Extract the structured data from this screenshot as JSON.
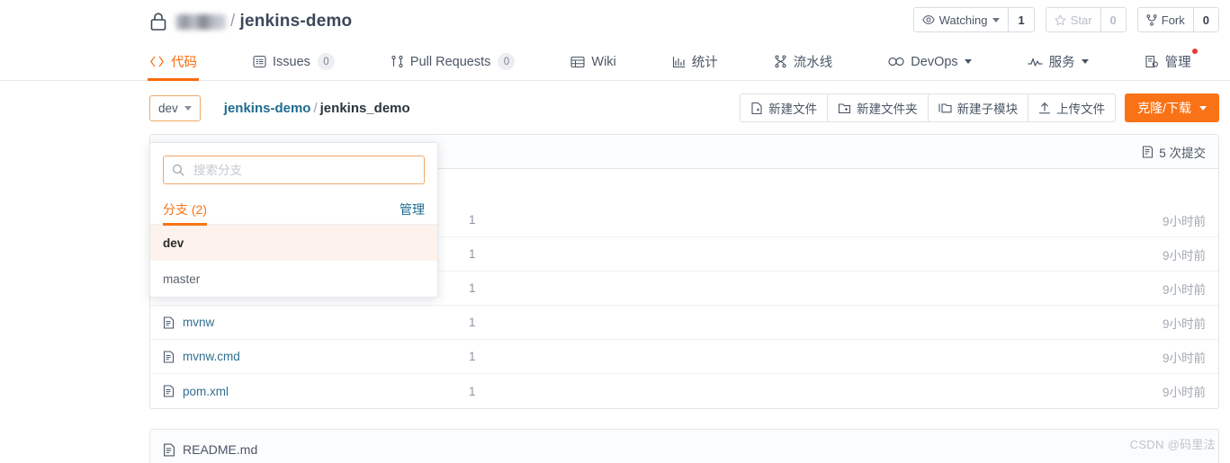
{
  "header": {
    "lock_icon": "lock-icon",
    "owner_redacted": "",
    "separator": "/",
    "repo_name": "jenkins-demo",
    "watch": {
      "icon": "eye-icon",
      "label": "Watching",
      "count": "1"
    },
    "star": {
      "icon": "star-icon",
      "label": "Star",
      "count": "0"
    },
    "fork": {
      "icon": "fork-icon",
      "label": "Fork",
      "count": "0"
    }
  },
  "nav": {
    "items": [
      {
        "icon": "code-icon",
        "label": "代码",
        "count": null,
        "active": true,
        "caret": false,
        "dot": false
      },
      {
        "icon": "issue-icon",
        "label": "Issues",
        "count": "0",
        "active": false,
        "caret": false,
        "dot": false
      },
      {
        "icon": "pr-icon",
        "label": "Pull Requests",
        "count": "0",
        "active": false,
        "caret": false,
        "dot": false
      },
      {
        "icon": "wiki-icon",
        "label": "Wiki",
        "count": null,
        "active": false,
        "caret": false,
        "dot": false
      },
      {
        "icon": "chart-icon",
        "label": "统计",
        "count": null,
        "active": false,
        "caret": false,
        "dot": false
      },
      {
        "icon": "pipe-icon",
        "label": "流水线",
        "count": null,
        "active": false,
        "caret": false,
        "dot": false
      },
      {
        "icon": "infinity-icon",
        "label": "DevOps",
        "count": null,
        "active": false,
        "caret": true,
        "dot": false
      },
      {
        "icon": "pulse-icon",
        "label": "服务",
        "count": null,
        "active": false,
        "caret": true,
        "dot": false
      },
      {
        "icon": "manage-icon",
        "label": "管理",
        "count": null,
        "active": false,
        "caret": false,
        "dot": true
      }
    ]
  },
  "toolbar": {
    "branch_button": {
      "label": "dev",
      "icon": "chevron-down-icon"
    },
    "breadcrumb": {
      "root": "jenkins-demo",
      "separator": "/",
      "current": "jenkins_demo"
    },
    "buttons": [
      {
        "icon": "new-file-icon",
        "label": "新建文件"
      },
      {
        "icon": "new-folder-icon",
        "label": "新建文件夹"
      },
      {
        "icon": "new-submodule-icon",
        "label": "新建子模块"
      },
      {
        "icon": "upload-icon",
        "label": "上传文件"
      }
    ],
    "primary_button": {
      "label": "克隆/下载",
      "icon": "chevron-down-icon"
    }
  },
  "file_table": {
    "commits": {
      "icon": "commit-icon",
      "label": "5 次提交"
    },
    "rows": [
      {
        "name": "",
        "message": "",
        "time": "",
        "hidden": true
      },
      {
        "name": "",
        "message": "1",
        "time": "9小时前",
        "hidden": true
      },
      {
        "name": "",
        "message": "1",
        "time": "9小时前",
        "hidden": true
      },
      {
        "name": "",
        "message": "1",
        "time": "9小时前",
        "hidden": true
      },
      {
        "name": "mvnw",
        "message": "1",
        "time": "9小时前",
        "hidden": false
      },
      {
        "name": "mvnw.cmd",
        "message": "1",
        "time": "9小时前",
        "hidden": false
      },
      {
        "name": "pom.xml",
        "message": "1",
        "time": "9小时前",
        "hidden": false
      }
    ]
  },
  "readme": {
    "icon": "file-icon",
    "label": "README.md"
  },
  "branch_dropdown": {
    "search": {
      "icon": "search-icon",
      "placeholder": "搜索分支",
      "value": ""
    },
    "tab_label": "分支 (2)",
    "manage_label": "管理",
    "branches": [
      {
        "name": "dev",
        "selected": true
      },
      {
        "name": "master",
        "selected": false
      }
    ]
  },
  "watermark": "CSDN @码里法",
  "colors": {
    "accent": "#f97316",
    "link": "#1f6b8f",
    "title": "#3b4859",
    "muted": "#a2a9b3",
    "dot": "#e8392f"
  }
}
